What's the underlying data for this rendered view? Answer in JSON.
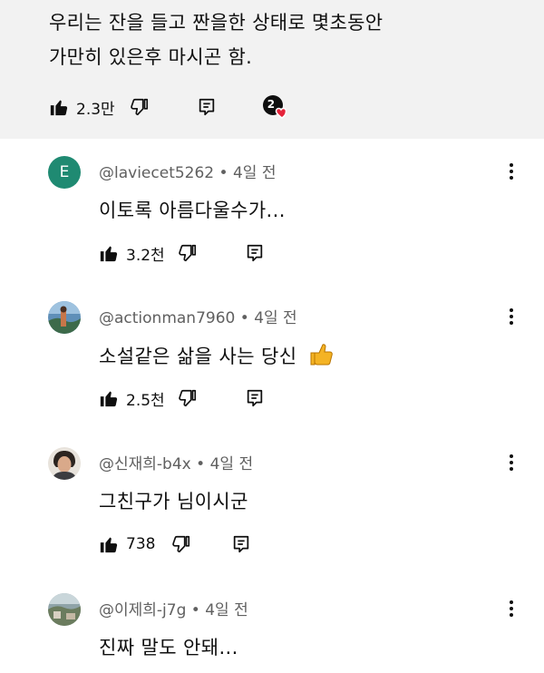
{
  "parent_comment": {
    "text_line1": "우리는 잔을 들고 짠을한 상태로 몇초동안",
    "text_line2": "가만히 있은후 마시곤 함.",
    "like_count": "2.3만",
    "reply_badge_count": "2"
  },
  "comments": [
    {
      "avatar_letter": "E",
      "avatar_color": "#1f8a72",
      "author": "@laviecet5262",
      "time": "4일 전",
      "text": "이토록 아름다울수가...",
      "like_count": "3.2천"
    },
    {
      "author": "@actionman7960",
      "time": "4일 전",
      "text": "소설같은 삶을 사는 당신",
      "emoji": "thumbs-up-emoji",
      "like_count": "2.5천"
    },
    {
      "author": "@신재희-b4x",
      "time": "4일 전",
      "text": "그친구가 님이시군",
      "like_count": "738"
    },
    {
      "author": "@이제희-j7g",
      "time": "4일 전",
      "text": "진짜 말도 안돼..."
    }
  ],
  "separator": " • "
}
